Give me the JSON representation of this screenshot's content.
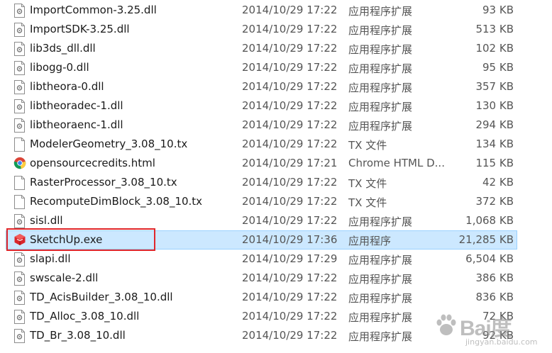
{
  "files": [
    {
      "name": "ImportCommon-3.25.dll",
      "date": "2014/10/29 17:22",
      "type": "应用程序扩展",
      "size": "93 KB",
      "icon": "dll-file-icon"
    },
    {
      "name": "ImportSDK-3.25.dll",
      "date": "2014/10/29 17:22",
      "type": "应用程序扩展",
      "size": "513 KB",
      "icon": "dll-file-icon"
    },
    {
      "name": "lib3ds_dll.dll",
      "date": "2014/10/29 17:22",
      "type": "应用程序扩展",
      "size": "102 KB",
      "icon": "dll-file-icon"
    },
    {
      "name": "libogg-0.dll",
      "date": "2014/10/29 17:22",
      "type": "应用程序扩展",
      "size": "95 KB",
      "icon": "dll-file-icon"
    },
    {
      "name": "libtheora-0.dll",
      "date": "2014/10/29 17:22",
      "type": "应用程序扩展",
      "size": "357 KB",
      "icon": "dll-file-icon"
    },
    {
      "name": "libtheoradec-1.dll",
      "date": "2014/10/29 17:22",
      "type": "应用程序扩展",
      "size": "130 KB",
      "icon": "dll-file-icon"
    },
    {
      "name": "libtheoraenc-1.dll",
      "date": "2014/10/29 17:22",
      "type": "应用程序扩展",
      "size": "294 KB",
      "icon": "dll-file-icon"
    },
    {
      "name": "ModelerGeometry_3.08_10.tx",
      "date": "2014/10/29 17:22",
      "type": "TX 文件",
      "size": "134 KB",
      "icon": "blank-file-icon"
    },
    {
      "name": "opensourcecredits.html",
      "date": "2014/10/29 17:21",
      "type": "Chrome HTML D...",
      "size": "115 KB",
      "icon": "chrome-icon"
    },
    {
      "name": "RasterProcessor_3.08_10.tx",
      "date": "2014/10/29 17:22",
      "type": "TX 文件",
      "size": "42 KB",
      "icon": "blank-file-icon"
    },
    {
      "name": "RecomputeDimBlock_3.08_10.tx",
      "date": "2014/10/29 17:22",
      "type": "TX 文件",
      "size": "372 KB",
      "icon": "blank-file-icon"
    },
    {
      "name": "sisl.dll",
      "date": "2014/10/29 17:22",
      "type": "应用程序扩展",
      "size": "1,068 KB",
      "icon": "dll-file-icon"
    },
    {
      "name": "SketchUp.exe",
      "date": "2014/10/29 17:36",
      "type": "应用程序",
      "size": "21,285 KB",
      "icon": "sketchup-icon",
      "selected": true
    },
    {
      "name": "slapi.dll",
      "date": "2014/10/29 17:29",
      "type": "应用程序扩展",
      "size": "6,504 KB",
      "icon": "dll-file-icon"
    },
    {
      "name": "swscale-2.dll",
      "date": "2014/10/29 17:22",
      "type": "应用程序扩展",
      "size": "386 KB",
      "icon": "dll-file-icon"
    },
    {
      "name": "TD_AcisBuilder_3.08_10.dll",
      "date": "2014/10/29 17:22",
      "type": "应用程序扩展",
      "size": "836 KB",
      "icon": "dll-file-icon"
    },
    {
      "name": "TD_Alloc_3.08_10.dll",
      "date": "2014/10/29 17:22",
      "type": "应用程序扩展",
      "size": "72 KB",
      "icon": "dll-file-icon"
    },
    {
      "name": "TD_Br_3.08_10.dll",
      "date": "2014/10/29 17:22",
      "type": "应用程序扩展",
      "size": "92 KB",
      "icon": "dll-file-icon"
    }
  ],
  "watermark": {
    "brand": "Bai度",
    "site": "jingyan.baidu.com"
  },
  "colors": {
    "selection": "#cce8ff",
    "highlight_box": "#e0262a",
    "sketchup_red": "#d9262c"
  }
}
